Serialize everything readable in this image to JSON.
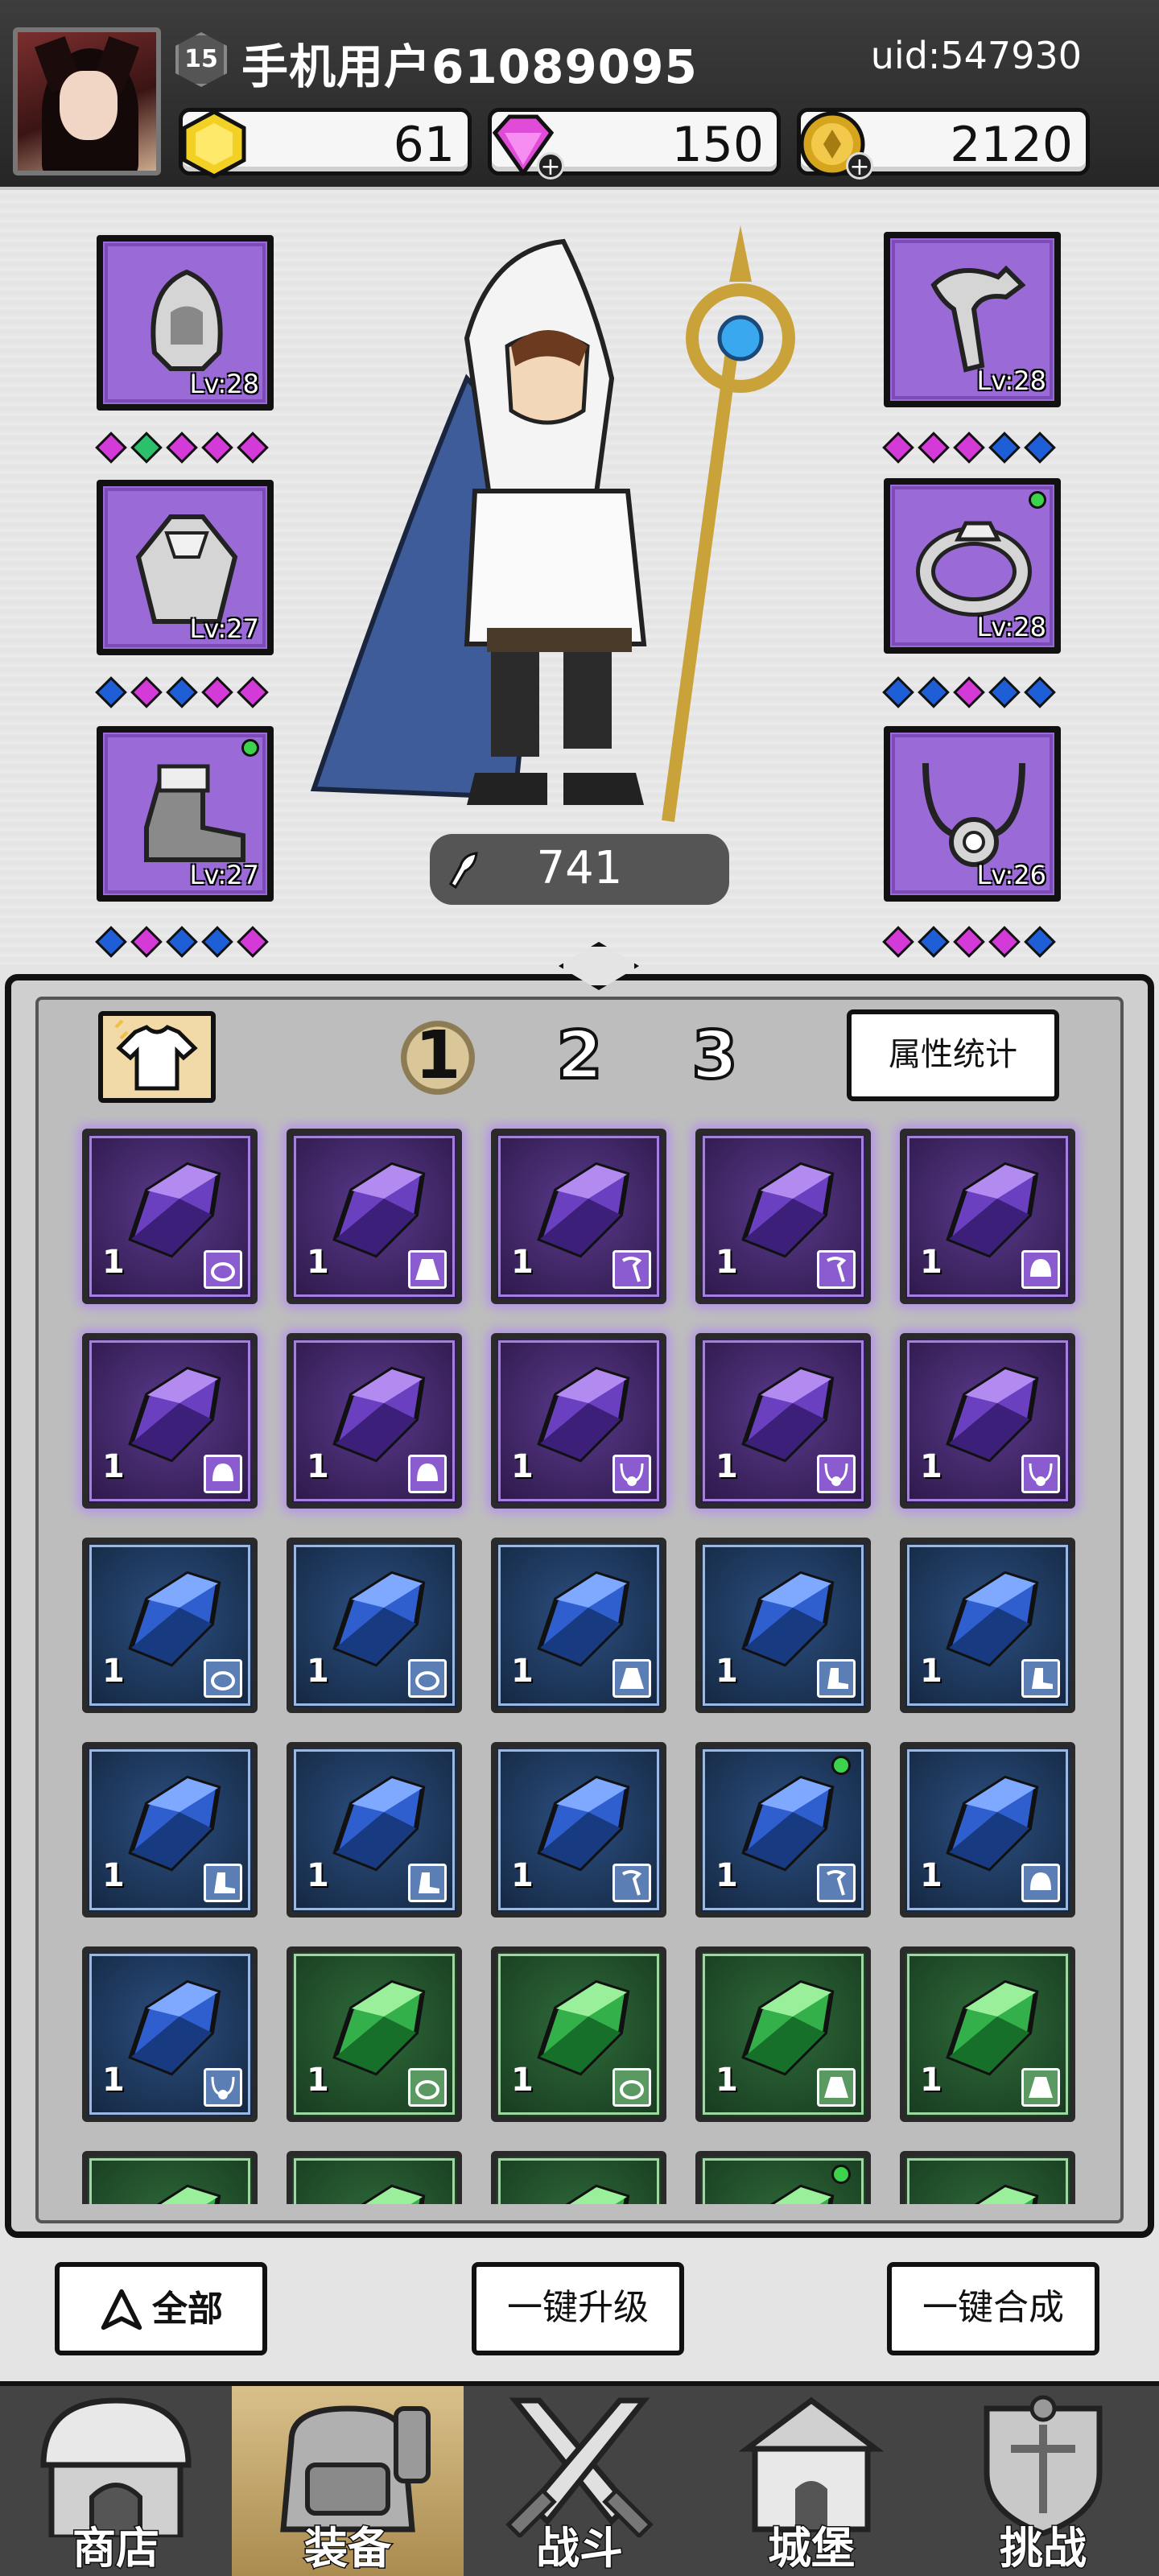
{
  "header": {
    "level": "15",
    "username": "手机用户61089095",
    "uid": "uid:547930",
    "currencies": [
      {
        "name": "gold-hex-icon",
        "value": "61",
        "color": "#f2d024"
      },
      {
        "name": "diamond-icon",
        "value": "150",
        "color": "#e04cd8"
      },
      {
        "name": "coin-icon",
        "value": "2120",
        "color": "#d6a51e"
      }
    ]
  },
  "equipment": {
    "left": [
      {
        "icon": "helmet-icon",
        "level": "Lv:28",
        "gems": [
          "p",
          "g",
          "p",
          "p",
          "p"
        ],
        "new": false
      },
      {
        "icon": "cloak-icon",
        "level": "Lv:27",
        "gems": [
          "b",
          "p",
          "b",
          "p",
          "p"
        ],
        "new": false
      },
      {
        "icon": "boot-icon",
        "level": "Lv:27",
        "gems": [
          "b",
          "p",
          "b",
          "b",
          "p"
        ],
        "new": true
      }
    ],
    "right": [
      {
        "icon": "staff-icon",
        "level": "Lv:28",
        "gems": [
          "p",
          "p",
          "p",
          "b",
          "b"
        ],
        "new": false
      },
      {
        "icon": "ring-icon",
        "level": "Lv:28",
        "gems": [
          "b",
          "b",
          "p",
          "b",
          "b"
        ],
        "new": true
      },
      {
        "icon": "necklace-icon",
        "level": "Lv:26",
        "gems": [
          "p",
          "b",
          "p",
          "p",
          "b"
        ],
        "new": false
      }
    ]
  },
  "combat_power": "741",
  "bag": {
    "pages": [
      "1",
      "2",
      "3"
    ],
    "active_page": 0,
    "stats_button": "属性统计",
    "items": [
      {
        "rarity": "purple",
        "count": "1",
        "type": "ring",
        "new": false
      },
      {
        "rarity": "purple",
        "count": "1",
        "type": "cloak",
        "new": false
      },
      {
        "rarity": "purple",
        "count": "1",
        "type": "staff",
        "new": false
      },
      {
        "rarity": "purple",
        "count": "1",
        "type": "staff",
        "new": false
      },
      {
        "rarity": "purple",
        "count": "1",
        "type": "helmet",
        "new": false
      },
      {
        "rarity": "purple",
        "count": "1",
        "type": "helmet",
        "new": false
      },
      {
        "rarity": "purple",
        "count": "1",
        "type": "helmet",
        "new": false
      },
      {
        "rarity": "purple",
        "count": "1",
        "type": "necklace",
        "new": false
      },
      {
        "rarity": "purple",
        "count": "1",
        "type": "necklace",
        "new": false
      },
      {
        "rarity": "purple",
        "count": "1",
        "type": "necklace",
        "new": false
      },
      {
        "rarity": "blue",
        "count": "1",
        "type": "ring",
        "new": false
      },
      {
        "rarity": "blue",
        "count": "1",
        "type": "ring",
        "new": false
      },
      {
        "rarity": "blue",
        "count": "1",
        "type": "cloak",
        "new": false
      },
      {
        "rarity": "blue",
        "count": "1",
        "type": "boot",
        "new": false
      },
      {
        "rarity": "blue",
        "count": "1",
        "type": "boot",
        "new": false
      },
      {
        "rarity": "blue",
        "count": "1",
        "type": "boot",
        "new": false
      },
      {
        "rarity": "blue",
        "count": "1",
        "type": "boot",
        "new": false
      },
      {
        "rarity": "blue",
        "count": "1",
        "type": "staff",
        "new": false
      },
      {
        "rarity": "blue",
        "count": "1",
        "type": "staff",
        "new": true
      },
      {
        "rarity": "blue",
        "count": "1",
        "type": "helmet",
        "new": false
      },
      {
        "rarity": "blue",
        "count": "1",
        "type": "necklace",
        "new": false
      },
      {
        "rarity": "green",
        "count": "1",
        "type": "ring",
        "new": false
      },
      {
        "rarity": "green",
        "count": "1",
        "type": "ring",
        "new": false
      },
      {
        "rarity": "green",
        "count": "1",
        "type": "cloak",
        "new": false
      },
      {
        "rarity": "green",
        "count": "1",
        "type": "cloak",
        "new": false
      },
      {
        "rarity": "green",
        "count": "",
        "type": "",
        "new": false
      },
      {
        "rarity": "green",
        "count": "",
        "type": "",
        "new": false
      },
      {
        "rarity": "green",
        "count": "",
        "type": "",
        "new": false
      },
      {
        "rarity": "green",
        "count": "",
        "type": "",
        "new": true
      },
      {
        "rarity": "green",
        "count": "",
        "type": "",
        "new": false
      }
    ]
  },
  "actions": {
    "filter": "全部",
    "upgrade_all": "一键升级",
    "merge_all": "一键合成"
  },
  "nav": [
    {
      "label": "商店",
      "icon": "shop-icon"
    },
    {
      "label": "装备",
      "icon": "backpack-icon"
    },
    {
      "label": "战斗",
      "icon": "crossed-swords-icon"
    },
    {
      "label": "城堡",
      "icon": "castle-icon"
    },
    {
      "label": "挑战",
      "icon": "shield-crest-icon"
    }
  ],
  "nav_active": 1
}
